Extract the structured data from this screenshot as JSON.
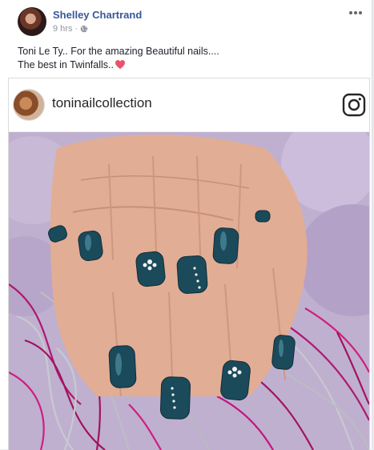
{
  "post": {
    "author": "Shelley Chartrand",
    "time": "9 hrs",
    "separator": "·",
    "privacy_icon": "globe-icon",
    "more_icon": "ellipsis-icon",
    "caption_line1": "Toni Le Ty.. For the amazing Beautiful nails....",
    "caption_line2": "The best in Twinfalls..",
    "caption_emoji": "heart-icon"
  },
  "embed": {
    "username": "toninailcollection",
    "logo_icon": "instagram-icon",
    "photo_subject": "manicured-nails-photo"
  },
  "colors": {
    "author_link": "#385898",
    "nail_polish": "#1b4a5a",
    "heart": "#e9546b",
    "tinsel": "#b0186e"
  }
}
